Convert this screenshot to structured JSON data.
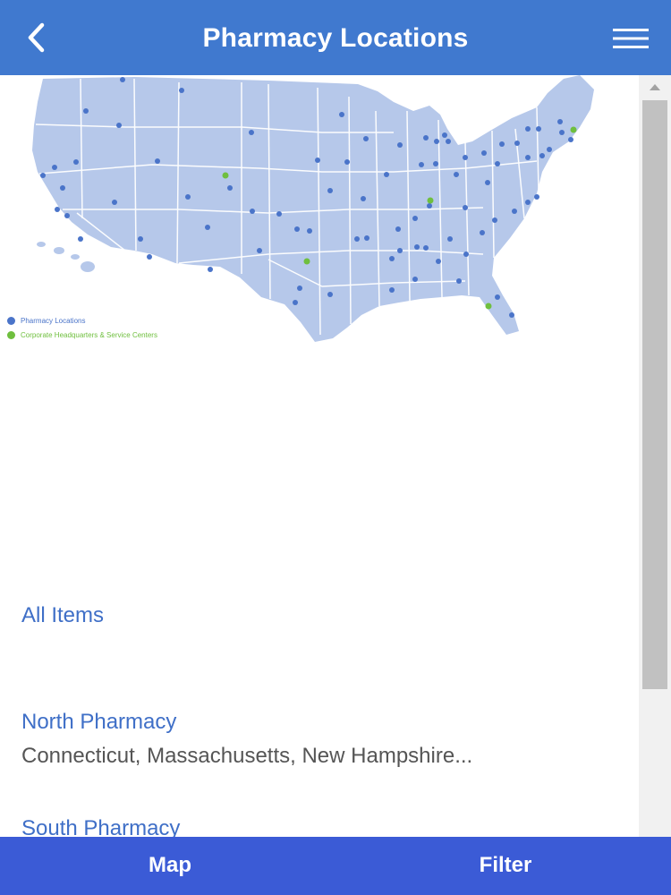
{
  "header": {
    "title": "Pharmacy Locations",
    "back_icon": "chevron-left-icon",
    "menu_icon": "hamburger-menu-icon"
  },
  "map": {
    "legend": [
      {
        "label": "Pharmacy Locations",
        "color": "#4a74c9"
      },
      {
        "label": "Corporate Headquarters & Service Centers",
        "color": "#6fbf3e"
      }
    ],
    "land_color": "#b6c8ea",
    "border_color": "#ffffff"
  },
  "list": {
    "all_items": "All Items",
    "items": [
      {
        "title": "North Pharmacy",
        "subtitle": "Connecticut, Massachusetts, New Hampshire..."
      },
      {
        "title": "South Pharmacy",
        "subtitle": ""
      }
    ]
  },
  "bottom_bar": {
    "map_label": "Map",
    "filter_label": "Filter"
  },
  "colors": {
    "header_bg": "#4079cf",
    "bottom_bg": "#3b5bd6",
    "link": "#3f6fc7",
    "subtitle": "#555555"
  }
}
